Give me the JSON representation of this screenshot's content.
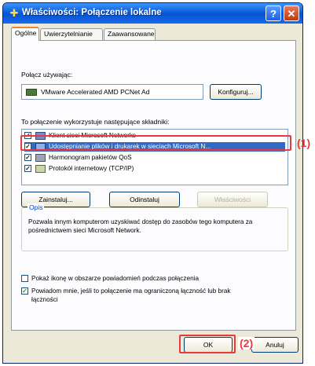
{
  "window": {
    "title": "Właściwości: Połączenie lokalne",
    "help_label": "?",
    "close_label": "✕",
    "title_icon": "network-connection-icon"
  },
  "tabs": [
    {
      "label": "Ogólne",
      "active": true
    },
    {
      "label": "Uwierzytelnianie",
      "active": false
    },
    {
      "label": "Zaawansowane",
      "active": false
    }
  ],
  "general": {
    "connect_using_label": "Połącz używając:",
    "adapter_name": "VMware Accelerated AMD PCNet Ad",
    "adapter_icon": "network-card-icon",
    "configure_label": "Konfiguruj...",
    "components_label": "To połączenie wykorzystuje następujące składniki:",
    "components": [
      {
        "label": "Klient sieci Microsoft Networks",
        "checked": true,
        "icon": "client-icon"
      },
      {
        "label": "Udostępnianie plików i drukarek w sieciach Microsoft N...",
        "checked": true,
        "icon": "file-printer-sharing-icon",
        "selected": true
      },
      {
        "label": "Harmonogram pakietów QoS",
        "checked": true,
        "icon": "qos-icon"
      },
      {
        "label": "Protokół internetowy (TCP/IP)",
        "checked": true,
        "icon": "protocol-icon"
      }
    ],
    "install_label": "Zainstaluj...",
    "uninstall_label": "Odinstaluj",
    "properties_label": "Właściwości",
    "description_title": "Opis",
    "description_text": "Pozwala innym komputerom uzyskiwać dostęp do zasobów tego komputera za pośrednictwem sieci Microsoft Network.",
    "show_icon_label": "Pokaż ikonę w obszarze powiadomień podczas połączenia",
    "show_icon_checked": false,
    "notify_label": "Powiadom mnie, jeśli to połączenie ma ograniczoną łączność lub brak łączności",
    "notify_checked": true
  },
  "footer": {
    "ok_label": "OK",
    "cancel_label": "Anuluj"
  },
  "annotations": {
    "callout_1": "(1)",
    "callout_2": "(2)",
    "color": "#e8393e"
  }
}
